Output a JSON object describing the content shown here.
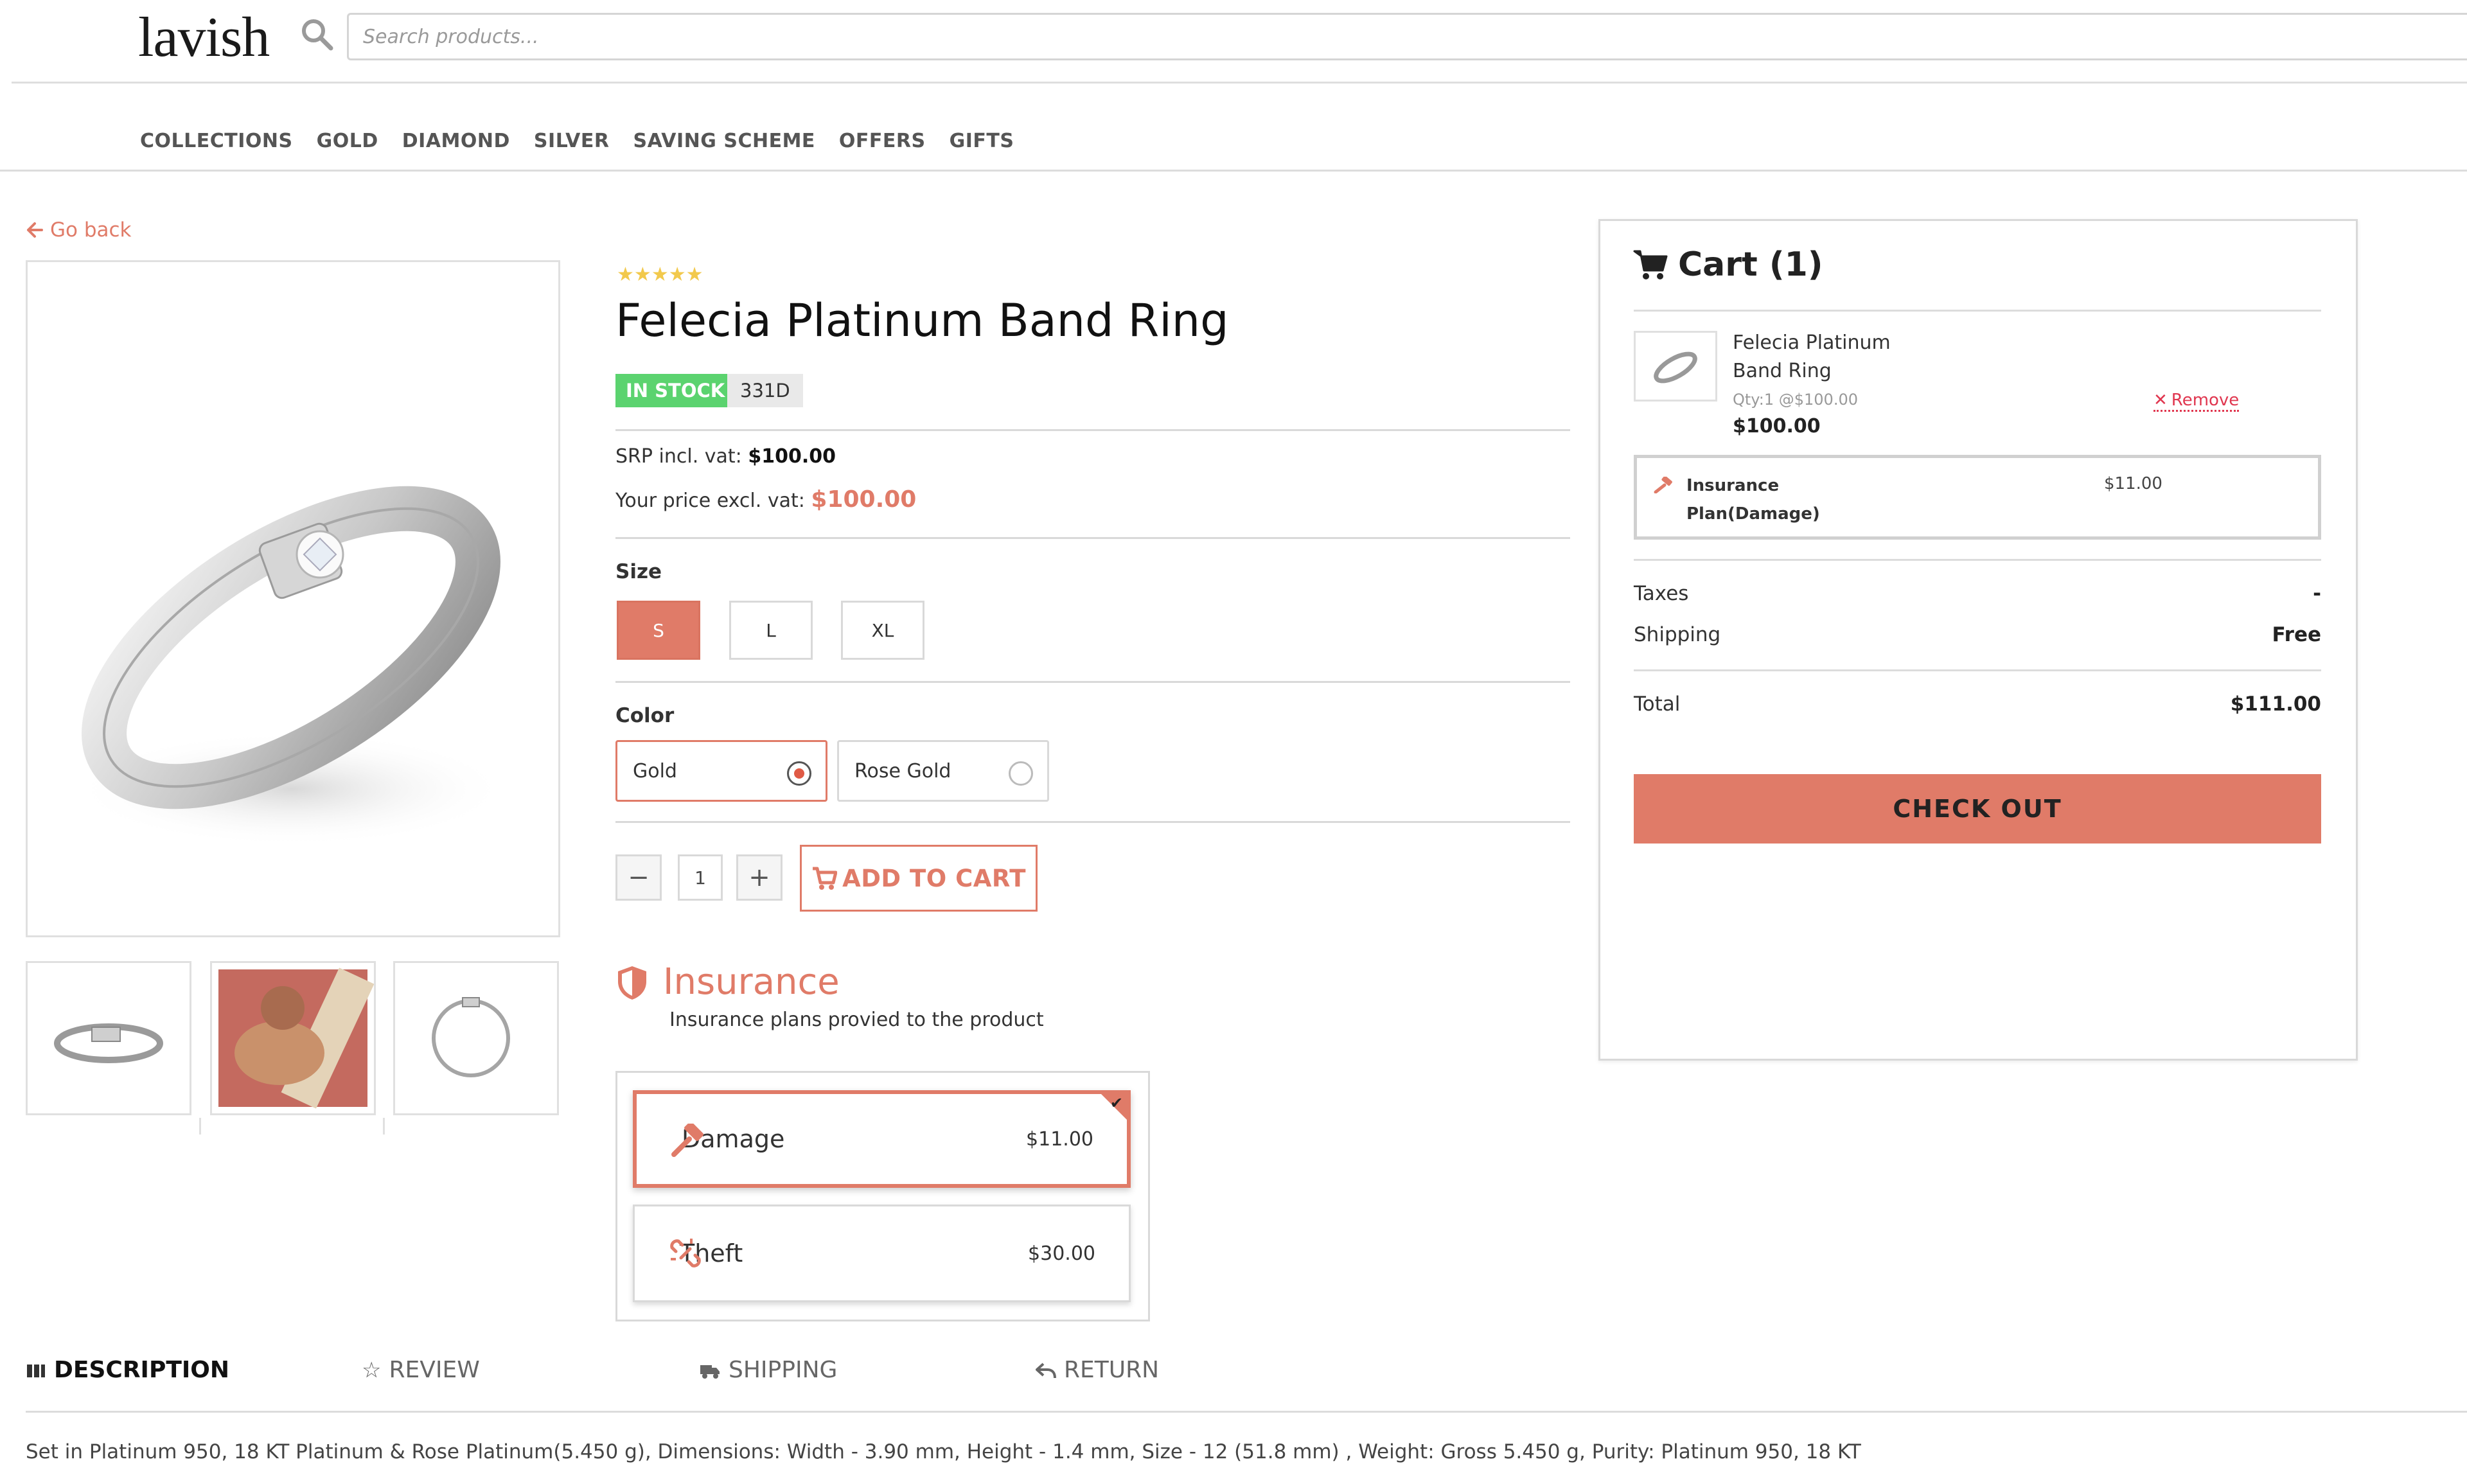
{
  "header": {
    "logo": "lavish",
    "search": {
      "placeholder": "Search products..."
    },
    "nav": [
      "COLLECTIONS",
      "GOLD",
      "DIAMOND",
      "SILVER",
      "SAVING SCHEME",
      "OFFERS",
      "GIFTS"
    ]
  },
  "go_back": "Go back",
  "product": {
    "rating": 5,
    "title": "Felecia Platinum Band Ring",
    "stock_badge": "IN STOCK",
    "sku": "331D",
    "srp_label": "SRP incl. vat:",
    "srp_value": "$100.00",
    "price_label": "Your price excl. vat:",
    "price_value": "$100.00",
    "size_label": "Size",
    "sizes": [
      "S",
      "L",
      "XL"
    ],
    "selected_size": "S",
    "color_label": "Color",
    "colors": [
      "Gold",
      "Rose Gold"
    ],
    "selected_color": "Gold",
    "quantity": "1",
    "add_to_cart": "ADD TO CART"
  },
  "insurance": {
    "title": "Insurance",
    "subtitle": "Insurance plans provied to the product",
    "plans": [
      {
        "name": "Damage",
        "price": "$11.00",
        "selected": true
      },
      {
        "name": "Theft",
        "price": "$30.00",
        "selected": false
      }
    ]
  },
  "tabs": [
    "DESCRIPTION",
    "REVIEW",
    "SHIPPING",
    "RETURN"
  ],
  "active_tab": "DESCRIPTION",
  "description": "Set in Platinum 950, 18 KT Platinum & Rose Platinum(5.450 g), Dimensions: Width - 3.90 mm, Height - 1.4 mm, Size - 12 (51.8 mm) , Weight: Gross 5.450 g, Purity: Platinum 950, 18 KT",
  "cart": {
    "title": "Cart (1)",
    "item": {
      "name": "Felecia Platinum Band Ring",
      "qty_line": "Qty:1 @$100.00",
      "price": "$100.00",
      "remove": "Remove"
    },
    "insurance_line": {
      "name": "Insurance Plan(Damage)",
      "price": "$11.00"
    },
    "taxes_label": "Taxes",
    "taxes_value": "-",
    "shipping_label": "Shipping",
    "shipping_value": "Free",
    "total_label": "Total",
    "total_value": "$111.00",
    "checkout": "CHECK OUT"
  },
  "colors": {
    "accent": "#e07b68",
    "in_stock": "#5bd36f",
    "remove": "#e0364f",
    "star": "#f2c94c"
  }
}
